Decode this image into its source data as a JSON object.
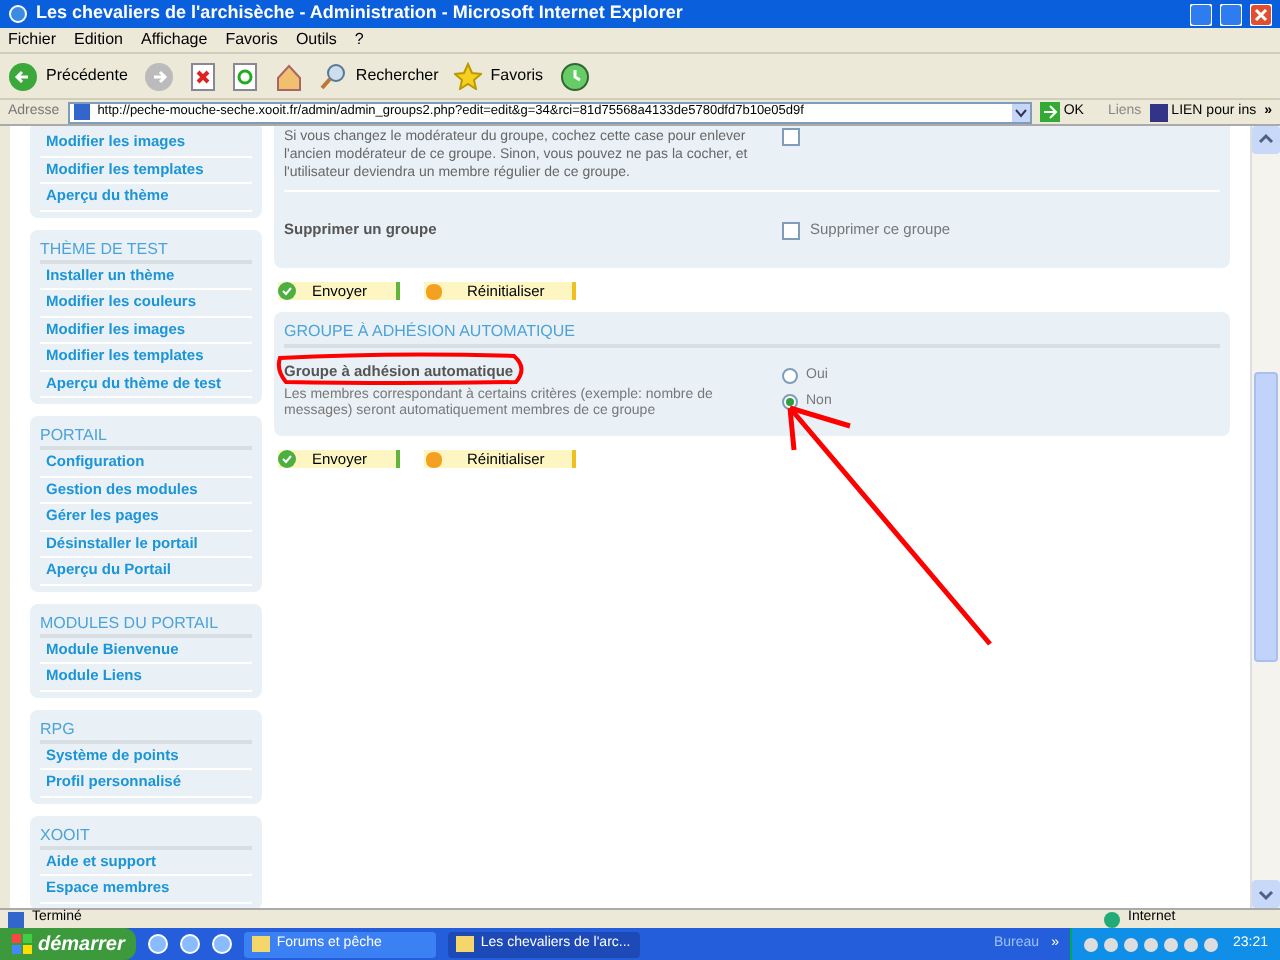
{
  "window": {
    "title": "Les chevaliers de l'archisèche - Administration - Microsoft Internet Explorer"
  },
  "menu_bar": [
    "Fichier",
    "Edition",
    "Affichage",
    "Favoris",
    "Outils",
    "?"
  ],
  "toolbar": {
    "back": "Précédente",
    "search": "Rechercher",
    "favorites": "Favoris"
  },
  "address_bar": {
    "label": "Adresse",
    "url": "http://peche-mouche-seche.xooit.fr/admin/admin_groups2.php?edit=edit&g=34&rci=81d75568a4133de5780dfd7b10e05d9f",
    "go": "OK",
    "links_label": "Liens",
    "link": "LIEN pour ins",
    "more": "»"
  },
  "sidebar": [
    {
      "items": [
        "Modifier les images",
        "Modifier les templates",
        "Aperçu du thème"
      ]
    },
    {
      "title": "THÈME DE TEST",
      "items": [
        "Installer un thème",
        "Modifier les couleurs",
        "Modifier les images",
        "Modifier les templates",
        "Aperçu du thème de test"
      ]
    },
    {
      "title": "PORTAIL",
      "items": [
        "Configuration",
        "Gestion des modules",
        "Gérer les pages",
        "Désinstaller le portail",
        "Aperçu du Portail"
      ]
    },
    {
      "title": "MODULES DU PORTAIL",
      "items": [
        "Module Bienvenue",
        "Module Liens"
      ]
    },
    {
      "title": "RPG",
      "items": [
        "Système de points",
        "Profil personnalisé"
      ]
    },
    {
      "title": "XOOIT",
      "items": [
        "Aide et support",
        "Espace membres"
      ]
    }
  ],
  "moderator_checkbox": {
    "checked": false
  },
  "moderator_note": "Si vous changez le modérateur du groupe, cochez cette case pour enlever l'ancien modérateur de ce groupe. Sinon, vous pouvez ne pas la cocher, et l'utilisateur deviendra un membre régulier de ce groupe.",
  "delete_group": {
    "label": "Supprimer un groupe",
    "checkbox": "Supprimer ce groupe",
    "checked": false
  },
  "buttons_1": {
    "submit": "Envoyer",
    "reset": "Réinitialiser"
  },
  "auto_group": {
    "title": "GROUPE À ADHÉSION AUTOMATIQUE",
    "label": "Groupe à adhésion automatique",
    "description": "Les membres correspondant à certains critères (exemple: nombre de messages) seront automatiquement membres de ce groupe",
    "options": [
      {
        "label": "Oui",
        "selected": false
      },
      {
        "label": "Non",
        "selected": true
      }
    ]
  },
  "buttons_2": {
    "submit": "Envoyer",
    "reset": "Réinitialiser"
  },
  "status_bar": {
    "text": "Terminé",
    "zone": "Internet"
  },
  "taskbar": {
    "start": "démarrer",
    "tasks": [
      {
        "label": "Forums et pêche",
        "selected": false
      },
      {
        "label": "Les chevaliers de l'arc...",
        "selected": true
      }
    ],
    "desktop": "Bureau",
    "more": "»",
    "clock": "23:21"
  }
}
